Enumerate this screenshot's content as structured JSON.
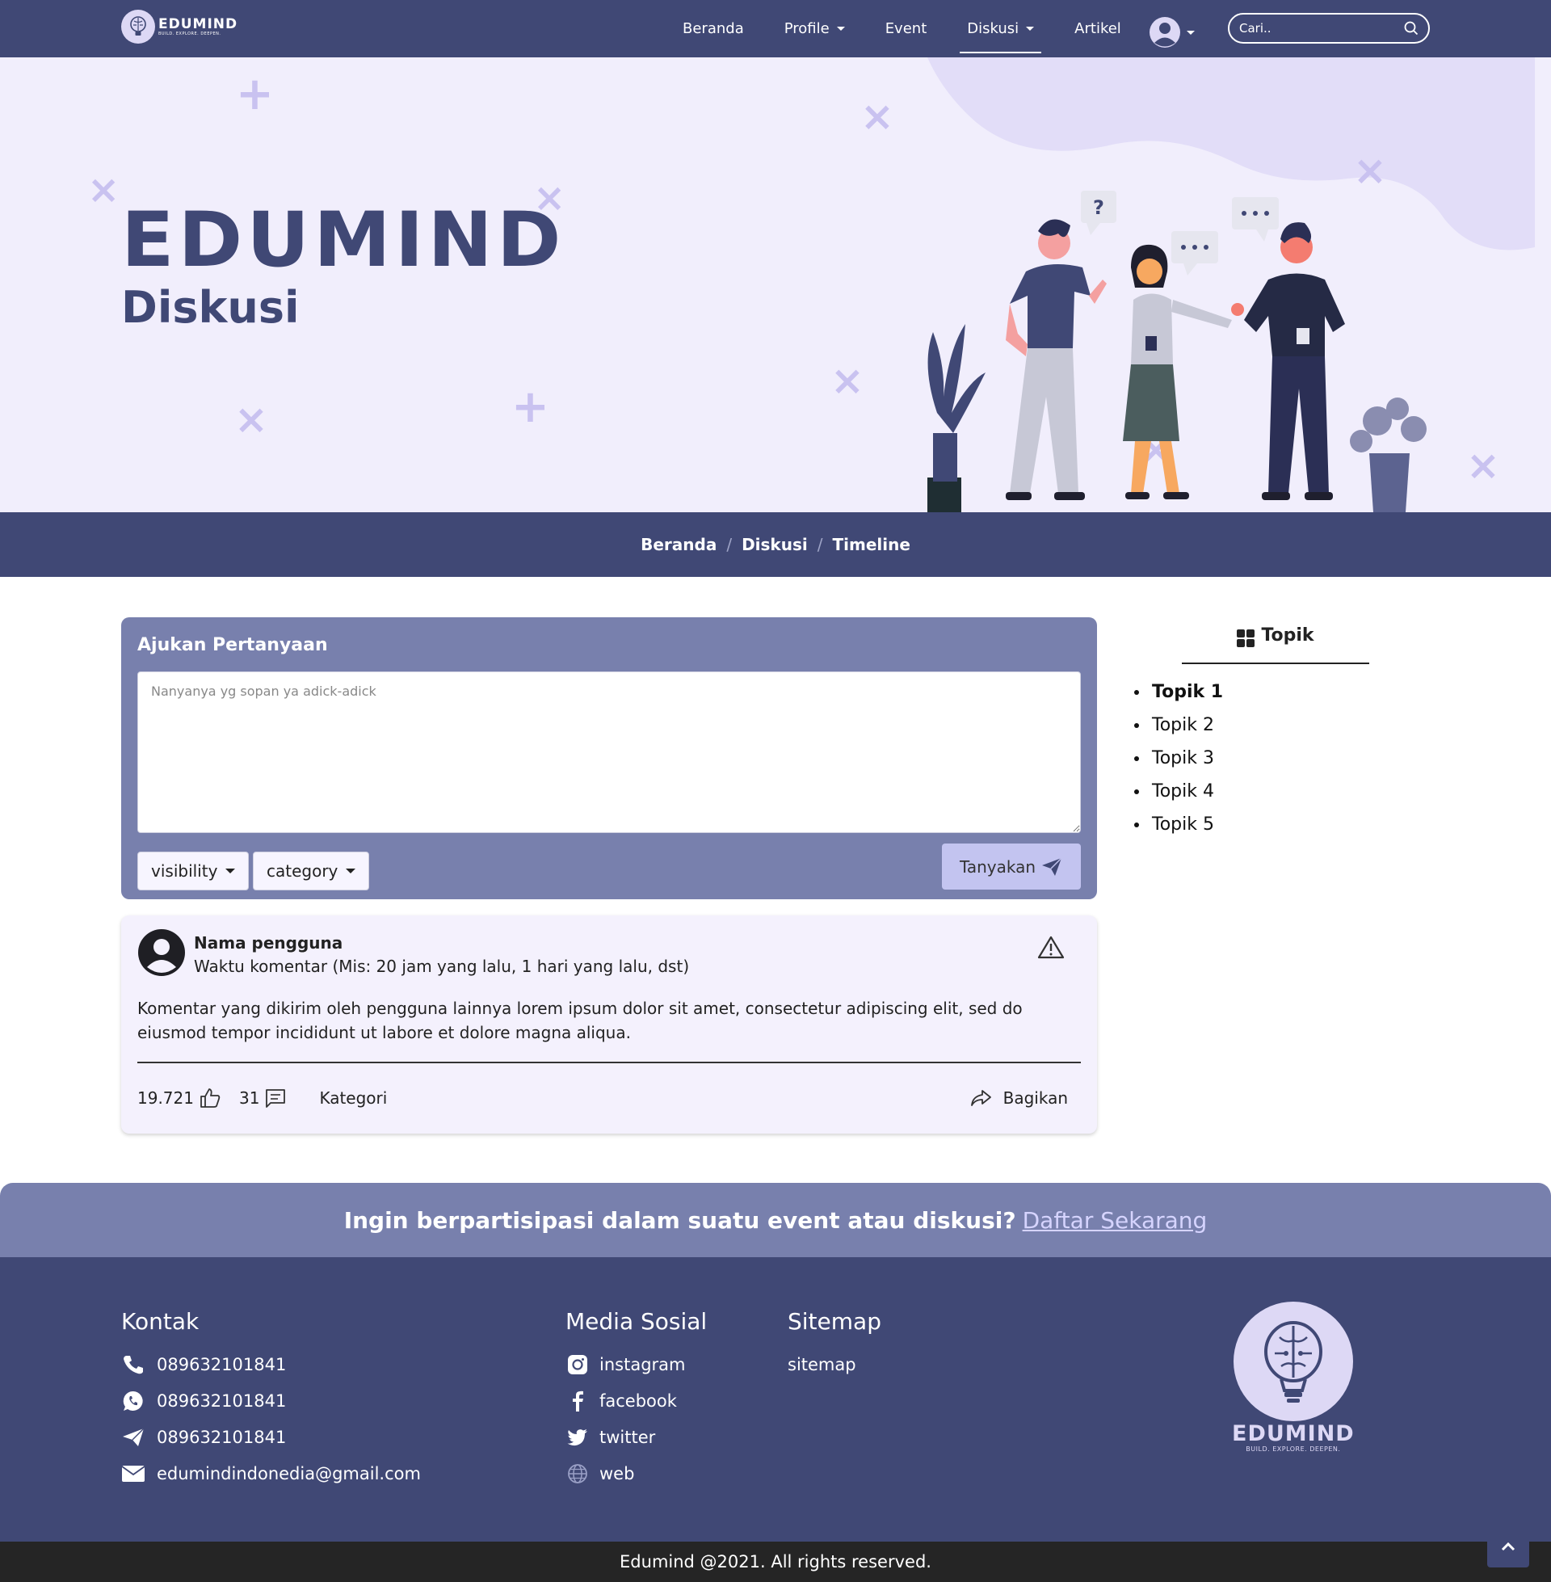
{
  "brand": {
    "name": "EDUMIND",
    "tagline": "BUILD. EXPLORE. DEEPEN."
  },
  "nav": {
    "items": [
      {
        "label": "Beranda"
      },
      {
        "label": "Profile"
      },
      {
        "label": "Event"
      },
      {
        "label": "Diskusi"
      },
      {
        "label": "Artikel"
      }
    ],
    "active": "Diskusi",
    "search_placeholder": "Cari.."
  },
  "hero": {
    "title": "EDUMIND",
    "subtitle": "Diskusi"
  },
  "breadcrumb": [
    "Beranda",
    "Diskusi",
    "Timeline"
  ],
  "ask": {
    "title": "Ajukan Pertanyaan",
    "placeholder": "Nanyanya yg sopan ya adick-adick",
    "visibility_label": "visibility",
    "category_label": "category",
    "submit_label": "Tanyakan"
  },
  "post": {
    "username": "Nama pengguna",
    "time": "Waktu komentar (Mis: 20 jam yang lalu, 1 hari yang lalu, dst)",
    "body": "Komentar yang dikirim oleh pengguna lainnya lorem ipsum dolor sit amet, consectetur adipiscing elit, sed do eiusmod tempor incididunt ut labore et dolore magna aliqua.",
    "likes": "19.721",
    "comments": "31",
    "category": "Kategori",
    "share_label": "Bagikan"
  },
  "sidebar": {
    "title": "Topik",
    "topics": [
      "Topik 1",
      "Topik 2",
      "Topik 3",
      "Topik 4",
      "Topik 5"
    ]
  },
  "cta": {
    "text": "Ingin berpartisipasi dalam suatu event atau diskusi?",
    "link": "Daftar Sekarang"
  },
  "footer": {
    "contact": {
      "heading": "Kontak",
      "phone": "089632101841",
      "whatsapp": "089632101841",
      "telegram": "089632101841",
      "email": "edumindindonedia@gmail.com"
    },
    "social": {
      "heading": "Media Sosial",
      "instagram": "instagram",
      "facebook": "facebook",
      "twitter": "twitter",
      "web": "web"
    },
    "sitemap": {
      "heading": "Sitemap",
      "link": "sitemap"
    },
    "logo_name": "EDUMIND",
    "logo_tagline": "BUILD. EXPLORE. DEEPEN."
  },
  "copyright": "Edumind @2021. All rights reserved.",
  "colors": {
    "primary": "#404875",
    "accent": "#7880ad",
    "hero_bg": "#f1eefc",
    "card_bg": "#f4f1fd",
    "send_button": "#c3c4f0",
    "footer_bottom": "#252525"
  },
  "icons": {
    "brand": "brain-bulb-icon",
    "user": "user-circle-icon",
    "search": "search-icon",
    "send": "paper-plane-icon",
    "report": "warning-triangle-icon",
    "like": "thumbs-up-icon",
    "comment": "comment-icon",
    "share": "share-icon",
    "topics": "grid-icon",
    "phone": "phone-icon",
    "whatsapp": "whatsapp-icon",
    "telegram": "telegram-icon",
    "email": "envelope-icon",
    "instagram": "instagram-icon",
    "facebook": "facebook-icon",
    "twitter": "twitter-icon",
    "web": "globe-icon",
    "to_top": "chevron-up-icon"
  }
}
